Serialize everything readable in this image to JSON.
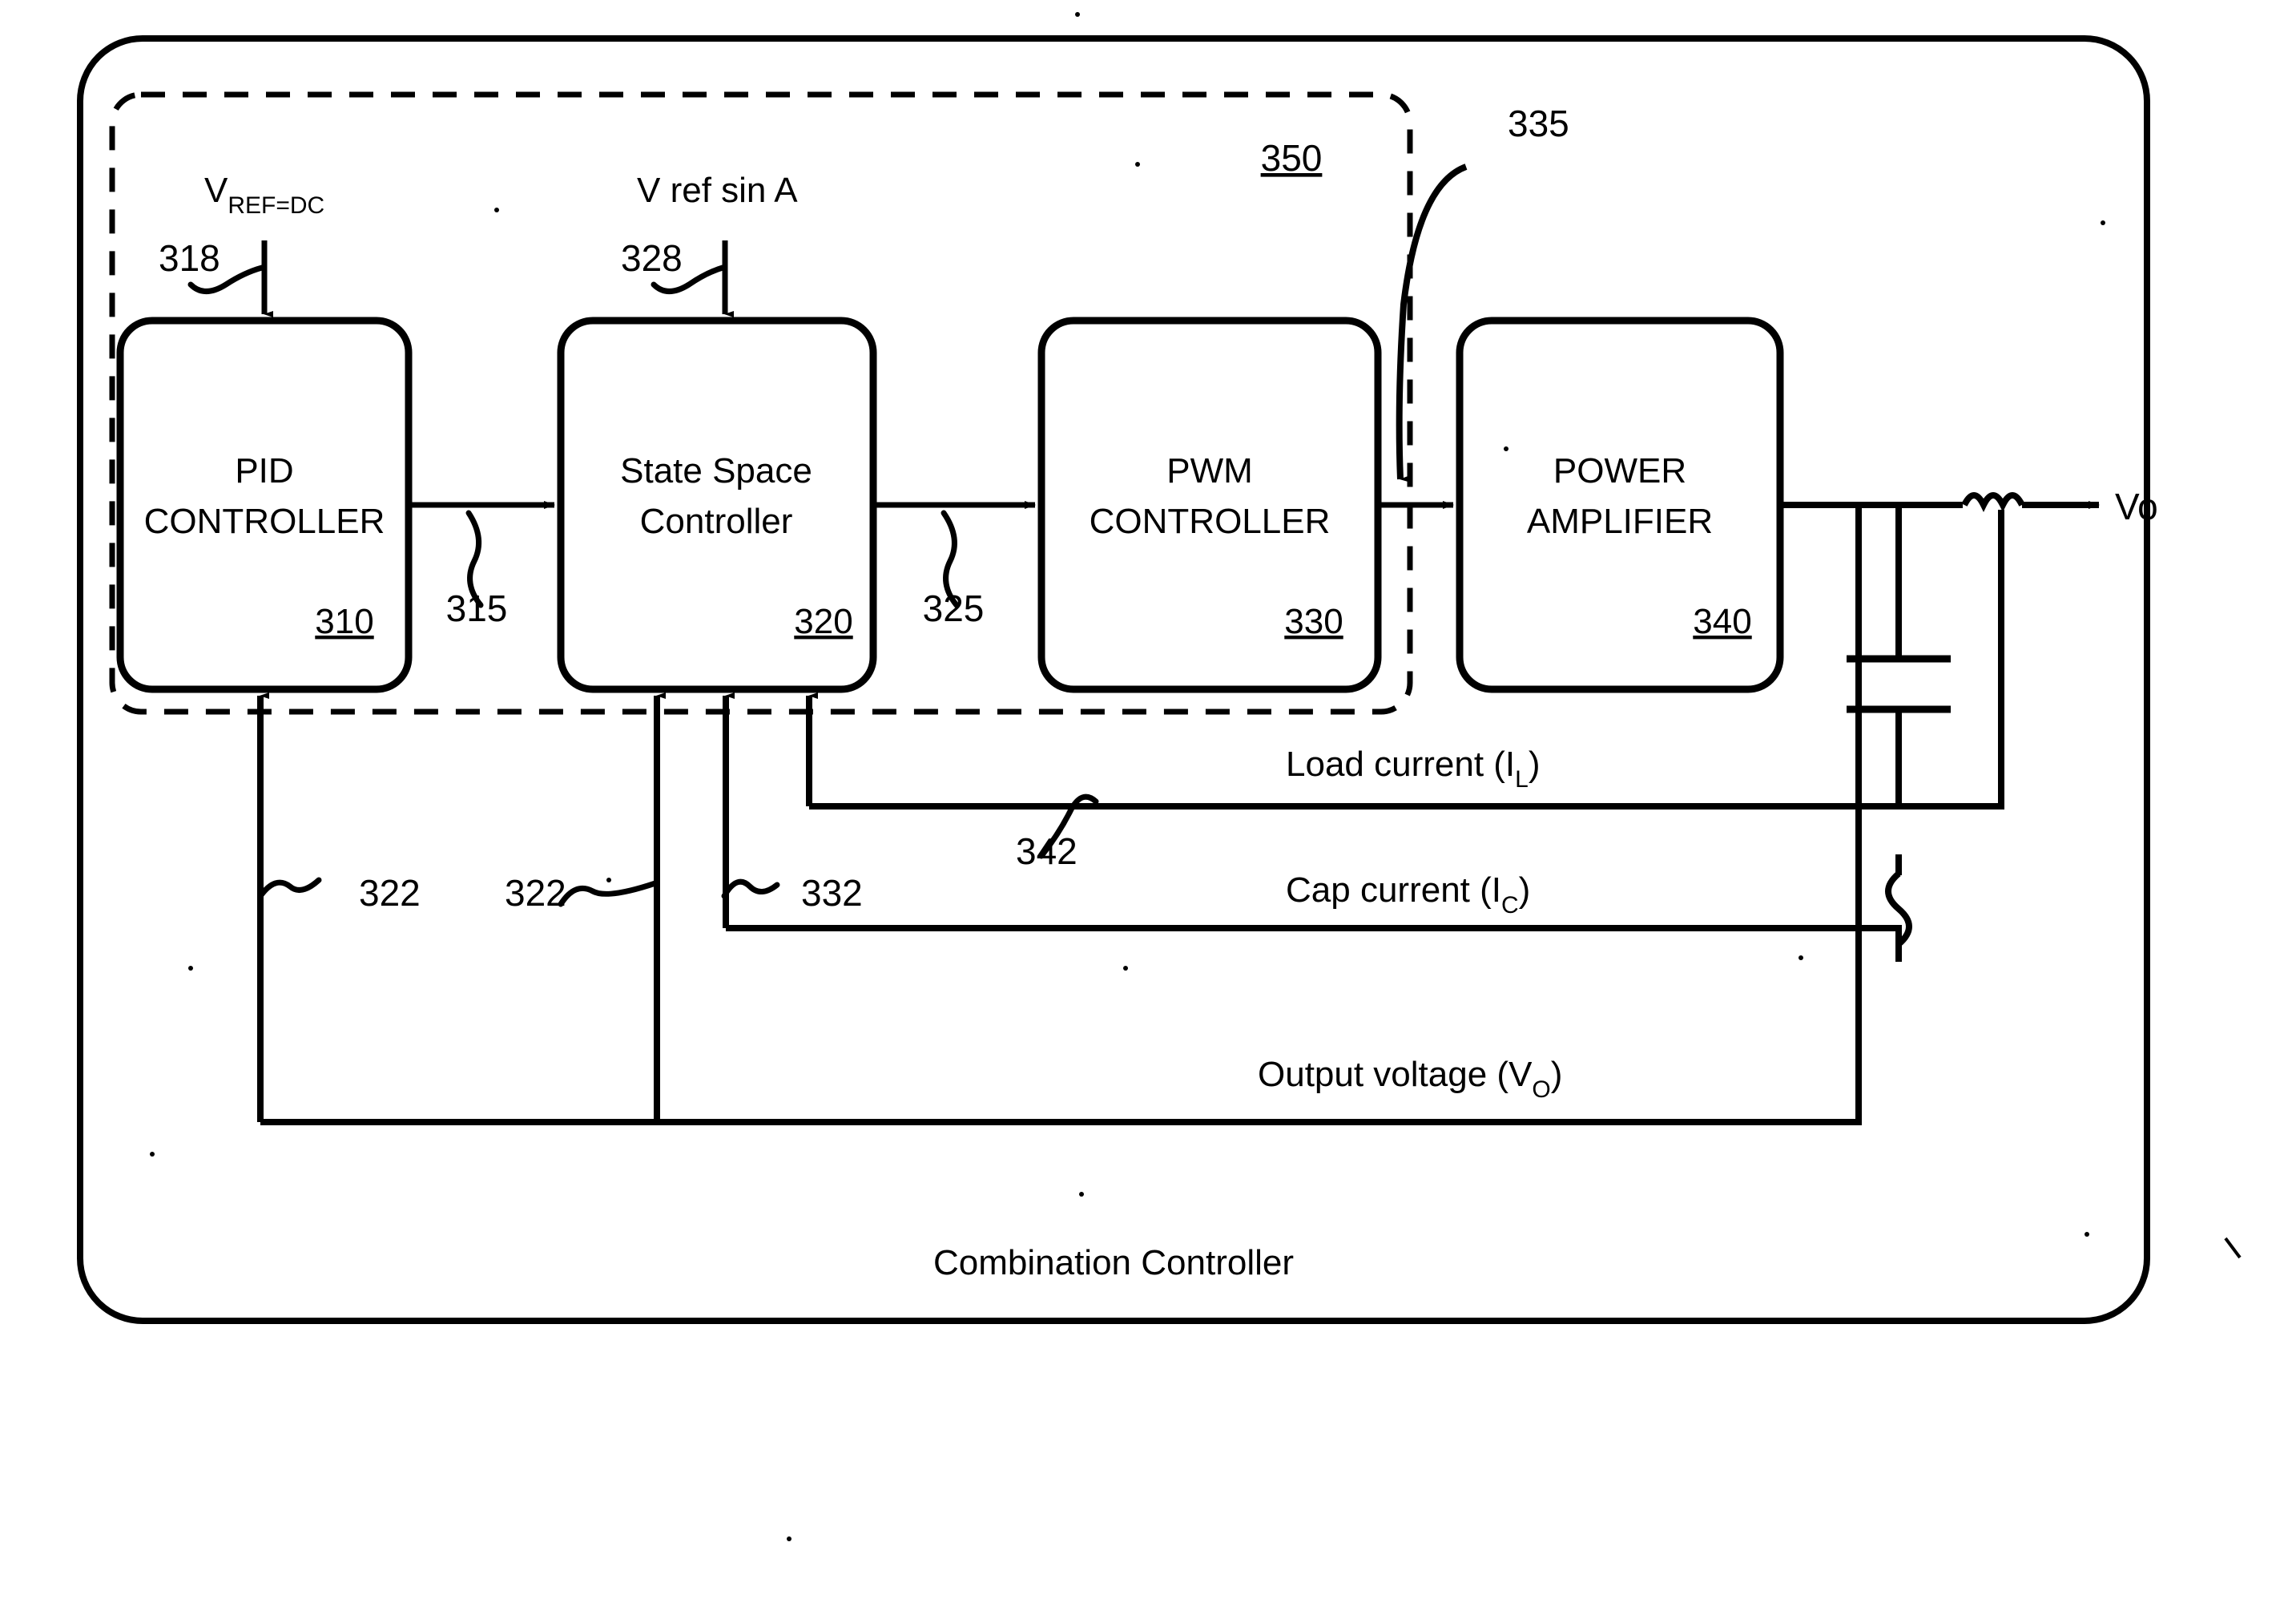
{
  "figure": {
    "title": "Combination Controller",
    "outer_label": "Combination Controller",
    "controller_group_ref": "350"
  },
  "blocks": [
    {
      "id": "pid",
      "line1": "PID",
      "line2": "CONTROLLER",
      "ref": "310",
      "case": "upper"
    },
    {
      "id": "state",
      "line1": "State Space",
      "line2": "Controller",
      "ref": "320",
      "case": "mixed"
    },
    {
      "id": "pwm",
      "line1": "PWM",
      "line2": "CONTROLLER",
      "ref": "330",
      "case": "upper"
    },
    {
      "id": "amp",
      "line1": "POWER",
      "line2": "AMPLIFIER",
      "ref": "340",
      "case": "upper"
    }
  ],
  "inputs": [
    {
      "id": "vref_dc",
      "main": "V",
      "sub": "REF=DC",
      "ref": "318"
    },
    {
      "id": "vref_sin",
      "main": "V ref sin A",
      "sub": "",
      "ref": "328"
    }
  ],
  "connections": [
    {
      "id": "pid_to_state",
      "ref": "315"
    },
    {
      "id": "state_to_pwm",
      "ref": "325"
    },
    {
      "id": "pwm_to_amp",
      "ref": "335"
    }
  ],
  "feedback": [
    {
      "id": "load_current",
      "label": "Load current (I",
      "sub": "L",
      "tail": ")",
      "ref": "342"
    },
    {
      "id": "cap_current",
      "label": "Cap current (I",
      "sub": "C",
      "tail": ")",
      "ref": "332"
    },
    {
      "id": "output_voltage",
      "label": "Output voltage (V",
      "sub": "O",
      "tail": ")",
      "ref": "322"
    }
  ],
  "feedback_refs": {
    "to_pid": "322",
    "to_state_vo": "322",
    "to_state_ic": "332",
    "to_state_il": "342"
  },
  "output": {
    "label": "Vo",
    "inductor": "inductor-symbol",
    "capacitor": "capacitor-symbol",
    "resistor": "resistor-symbol"
  },
  "colors": {
    "stroke": "#000000",
    "background": "#ffffff"
  }
}
